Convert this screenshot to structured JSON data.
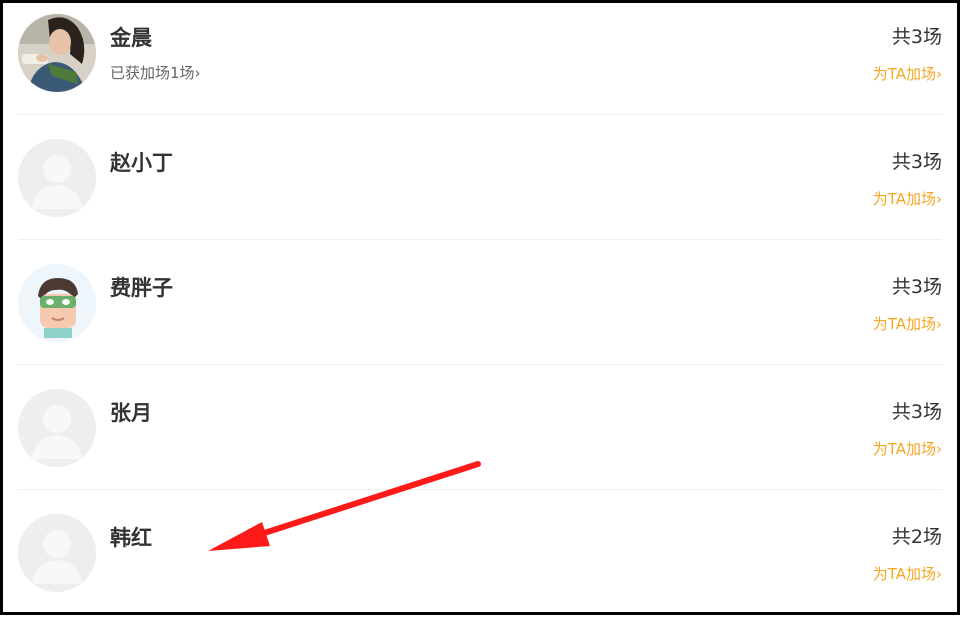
{
  "colors": {
    "accent": "#f5a623",
    "annotation_arrow": "#ff1a1a"
  },
  "rows": [
    {
      "name": "金晨",
      "sub": "已获加场1场",
      "sub_chevron": "›",
      "count": "共3场",
      "action": "为TA加场",
      "action_chevron": "›",
      "avatar": "photo"
    },
    {
      "name": "赵小丁",
      "count": "共3场",
      "action": "为TA加场",
      "action_chevron": "›",
      "avatar": "default-person"
    },
    {
      "name": "费胖子",
      "count": "共3场",
      "action": "为TA加场",
      "action_chevron": "›",
      "avatar": "cartoon-masked-face"
    },
    {
      "name": "张月",
      "count": "共3场",
      "action": "为TA加场",
      "action_chevron": "›",
      "avatar": "default-person"
    },
    {
      "name": "韩红",
      "count": "共2场",
      "action": "为TA加场",
      "action_chevron": "›",
      "avatar": "default-person"
    }
  ]
}
